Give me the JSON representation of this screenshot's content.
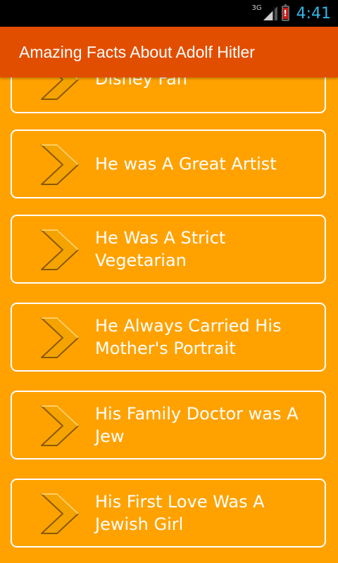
{
  "status_bar": {
    "network_type": "3G",
    "battery_alert": "!",
    "time": "4:41",
    "time_color": "#33b5e5"
  },
  "app_bar": {
    "title": "Amazing Facts About Adolf Hitler",
    "background": "#e24e00"
  },
  "colors": {
    "list_background": "#ffa200",
    "chevron_fill": "#f5a300",
    "card_border": "#ffffff"
  },
  "list": {
    "items": [
      {
        "label": "Disney Fan",
        "icon": "chevron-right-icon"
      },
      {
        "label": "He was A Great Artist",
        "icon": "chevron-right-icon"
      },
      {
        "label": "He Was A Strict Vegetarian",
        "icon": "chevron-right-icon"
      },
      {
        "label": "He Always Carried His Mother's Portrait",
        "icon": "chevron-right-icon"
      },
      {
        "label": "His Family Doctor was A Jew",
        "icon": "chevron-right-icon"
      },
      {
        "label": "His First Love Was A Jewish Girl",
        "icon": "chevron-right-icon"
      }
    ]
  }
}
